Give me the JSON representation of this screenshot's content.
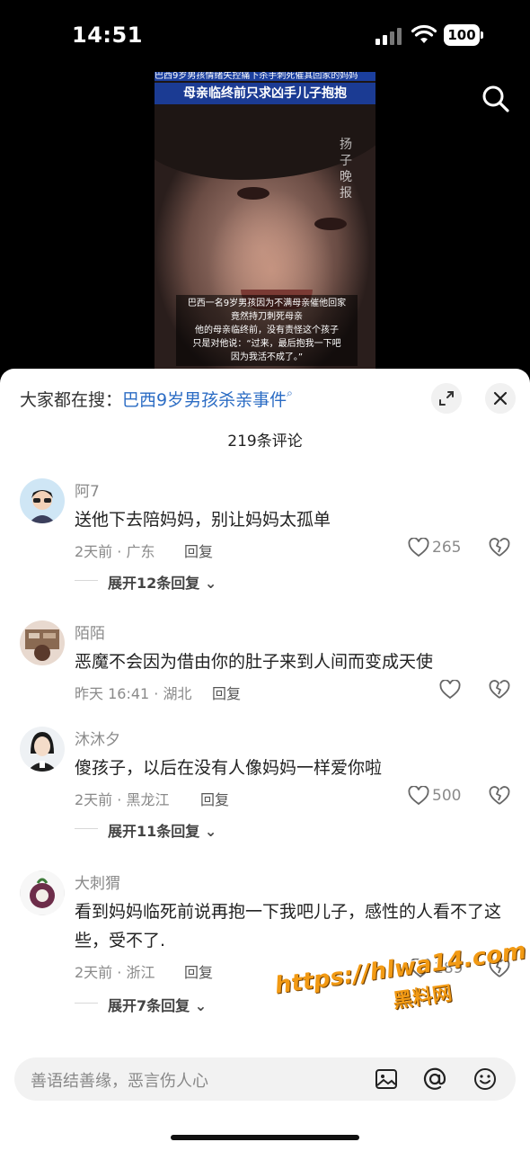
{
  "status_bar": {
    "time": "14:51",
    "battery": "100"
  },
  "video": {
    "title_top": "巴西9岁男孩情绪失控痛下杀手刺死催其回家的妈妈",
    "title": "母亲临终前只求凶手儿子抱抱",
    "watermark": "扬子晚报",
    "caption": [
      "巴西一名9岁男孩因为不满母亲催他回家",
      "竟然持刀刺死母亲",
      "他的母亲临终前，没有责怪这个孩子",
      "只是对他说：“过来，最后抱我一下吧",
      "因为我活不成了。”"
    ]
  },
  "hot_search": {
    "prefix": "大家都在搜：",
    "query": "巴西9岁男孩杀亲事件"
  },
  "comment_count": "219条评论",
  "comments": [
    {
      "user": "阿7",
      "text": "送他下去陪妈妈，别让妈妈太孤单",
      "meta": "2天前 · 广东",
      "reply": "回复",
      "likes": "265",
      "expand": "展开12条回复"
    },
    {
      "user": "陌陌",
      "text": "恶魔不会因为借由你的肚子来到人间而变成天使",
      "meta": "昨天 16:41 · 湖北",
      "reply": "回复",
      "likes": "",
      "expand": ""
    },
    {
      "user": "沐沐夕",
      "text": "傻孩子，以后在没有人像妈妈一样爱你啦",
      "meta": "2天前 · 黑龙江",
      "reply": "回复",
      "likes": "500",
      "expand": "展开11条回复"
    },
    {
      "user": "大刺猬",
      "text": "看到妈妈临死前说再抱一下我吧儿子，感性的人看不了这些，受不了.",
      "meta": "2天前 · 浙江",
      "reply": "回复",
      "likes": "189",
      "expand": "展开7条回复"
    }
  ],
  "input": {
    "placeholder": "善语结善缘，恶言伤人心"
  },
  "site_watermark": {
    "url": "https://hlwa14.com",
    "name": "黑料网"
  },
  "colors": {
    "link": "#2b6cc4",
    "watermark": "#f29a14"
  }
}
